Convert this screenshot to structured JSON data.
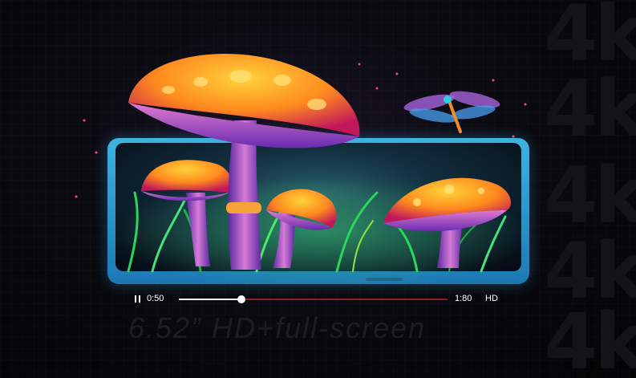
{
  "watermark": {
    "text": "4k"
  },
  "background_text": "6.52” HD+full-screen",
  "player": {
    "current_time": "0:50",
    "total_time": "1:80",
    "quality_label": "HD",
    "progress": 0.233
  },
  "icons": {
    "pause": "pause-icon"
  },
  "colors": {
    "phone_frame": "#3fb3e0",
    "progress_played": "#ffffff",
    "progress_remaining": "#8b1e28"
  }
}
